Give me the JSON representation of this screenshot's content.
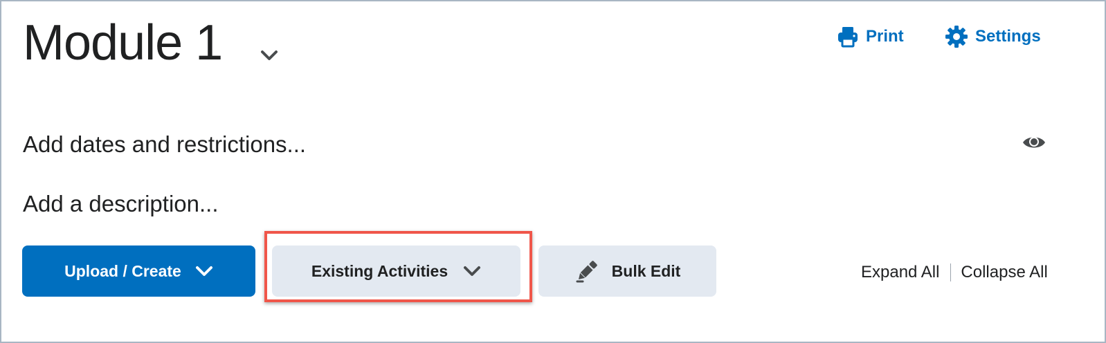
{
  "module": {
    "title": "Module 1",
    "chevron_icon": "chevron-down-icon"
  },
  "header_actions": {
    "print_label": "Print",
    "print_icon": "printer-icon",
    "settings_label": "Settings",
    "settings_icon": "gear-icon"
  },
  "details": {
    "dates_text": "Add dates and restrictions...",
    "description_text": "Add a description...",
    "visibility_icon": "eye-icon"
  },
  "toolbar": {
    "upload_label": "Upload / Create",
    "existing_label": "Existing Activities",
    "bulk_edit_label": "Bulk Edit",
    "bulk_edit_icon": "pencil-icon"
  },
  "outline": {
    "expand_label": "Expand All",
    "collapse_label": "Collapse All"
  },
  "colors": {
    "accent": "#006fbf",
    "secondary_button": "#e3e9f1",
    "highlight": "#f0564a"
  }
}
